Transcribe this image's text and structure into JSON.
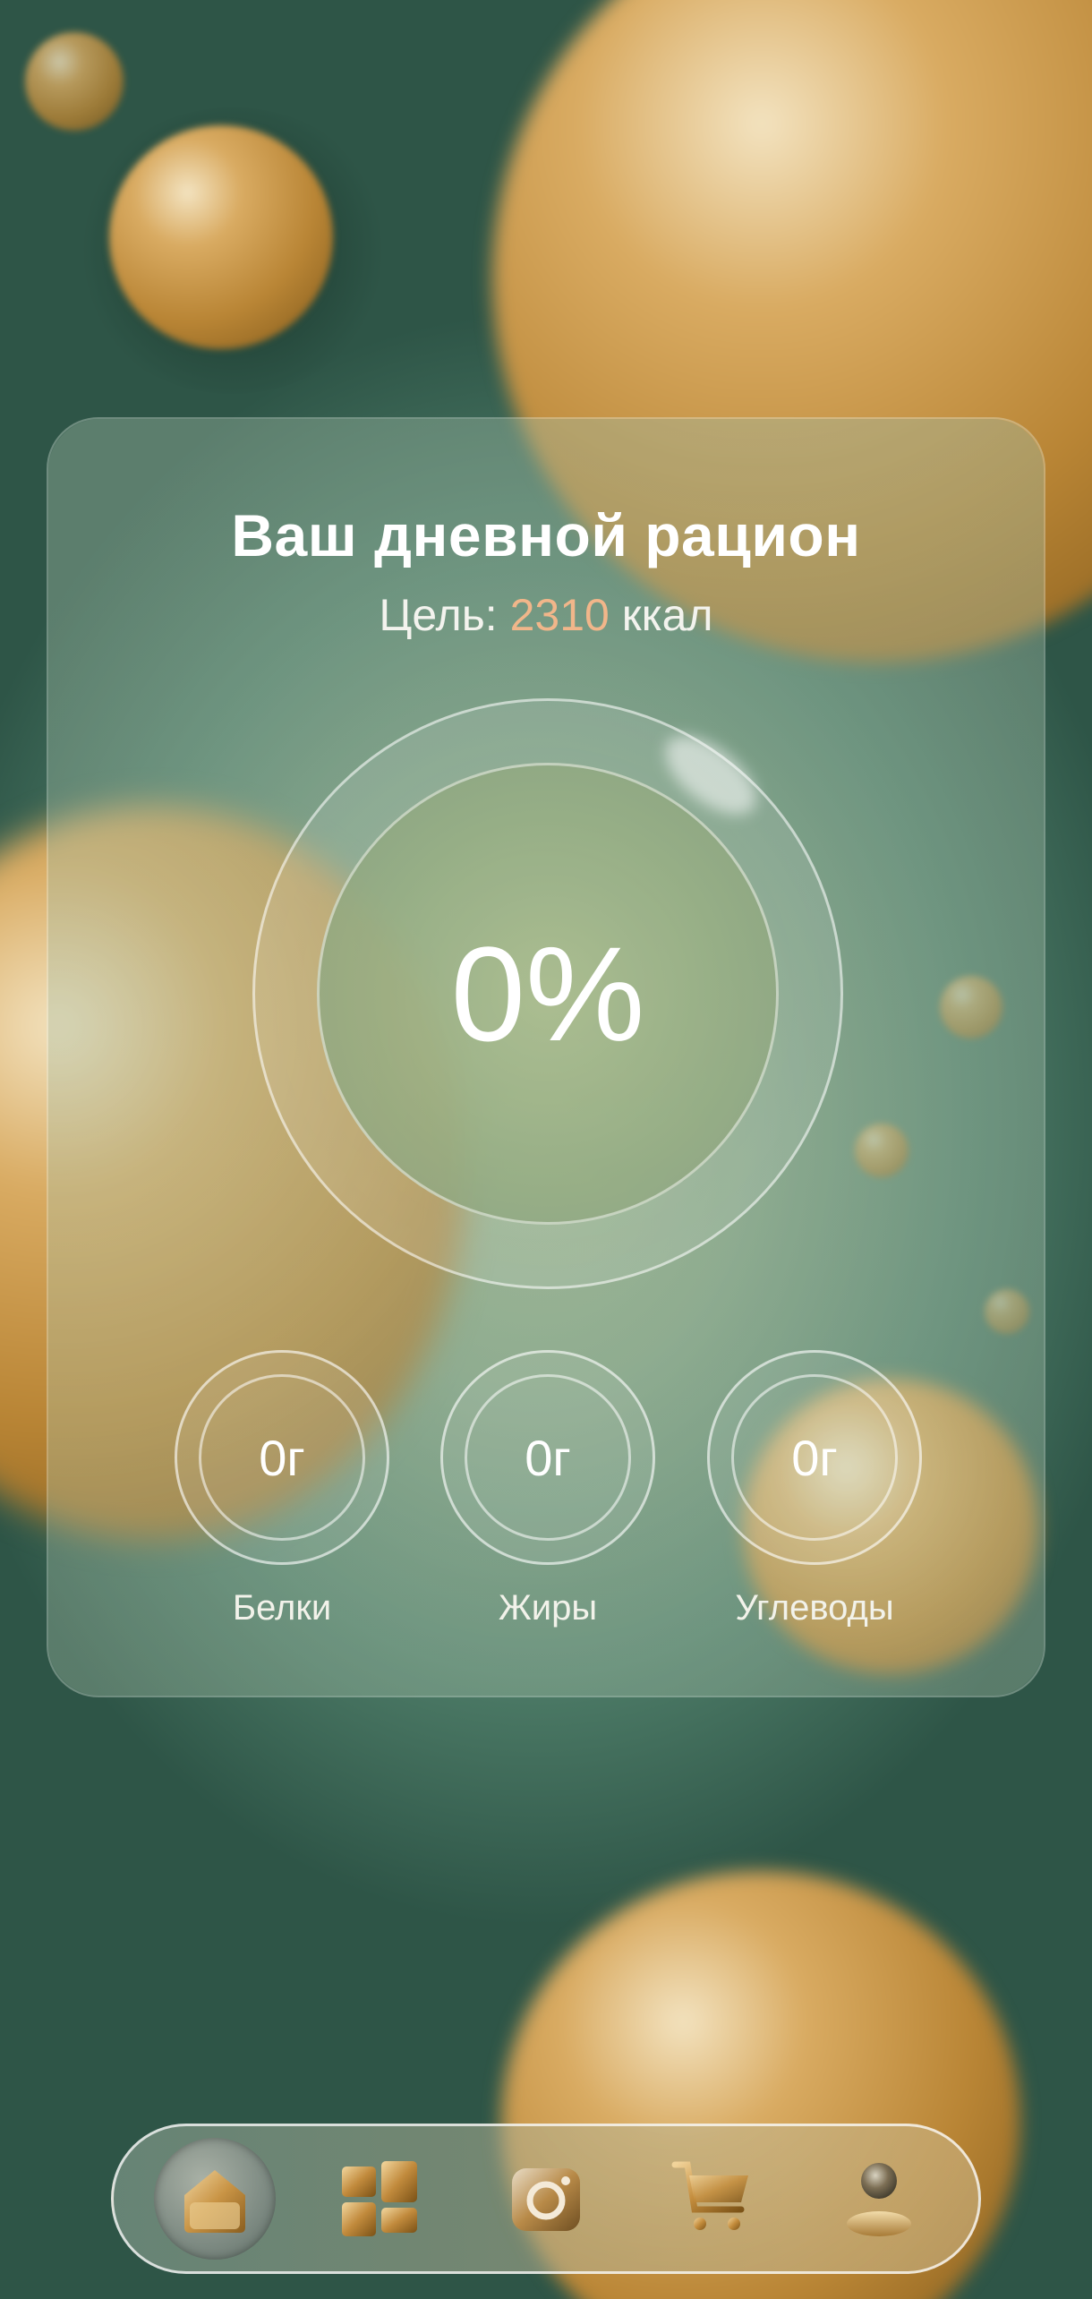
{
  "card": {
    "title": "Ваш дневной рацион",
    "goal_prefix": "Цель:",
    "goal_value": "2310",
    "goal_unit": "ккал"
  },
  "progress": {
    "percent_label": "0%",
    "percent_value": 0
  },
  "macros": [
    {
      "label": "Белки",
      "value": "0г"
    },
    {
      "label": "Жиры",
      "value": "0г"
    },
    {
      "label": "Углеводы",
      "value": "0г"
    }
  ],
  "nav": {
    "items": [
      {
        "icon": "home-icon",
        "active": true
      },
      {
        "icon": "grid-icon",
        "active": false
      },
      {
        "icon": "camera-icon",
        "active": false
      },
      {
        "icon": "cart-icon",
        "active": false
      },
      {
        "icon": "profile-icon",
        "active": false
      }
    ]
  },
  "colors": {
    "accent_goal": "#f1b68a",
    "gold": "#c99445",
    "background": "#2f5a4b"
  }
}
